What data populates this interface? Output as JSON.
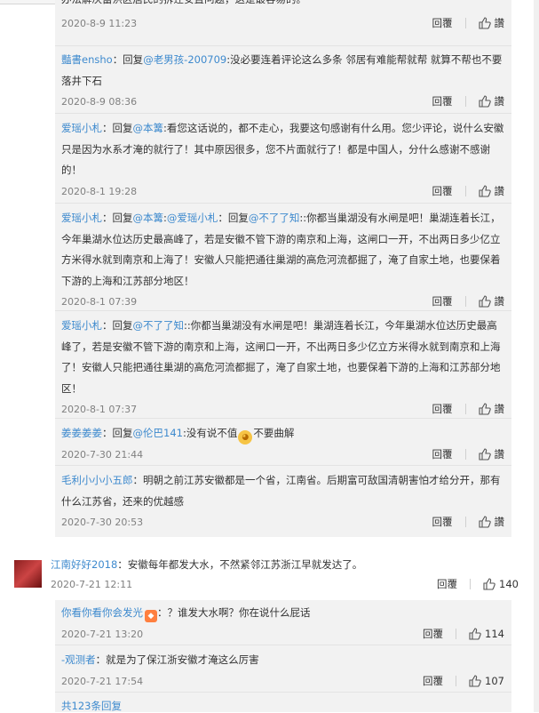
{
  "replies": [
    {
      "user": "",
      "text": "办法解决蓄洪区居民的拆迁安置问题，这是最容易的。",
      "time": "2020-8-9 11:23"
    },
    {
      "user": "豔書ensho",
      "prefix": "：回复",
      "mention": "@老男孩-200709",
      "text": ":没必要连着评论这么多条 邻居有难能帮就帮 就算不帮也不要落井下石",
      "time": "2020-8-9 08:36"
    },
    {
      "user": "爱瑶小札",
      "prefix": "：回复",
      "mention": "@本篝",
      "text": ":看您这话说的，都不走心，我要这句感谢有什么用。您少评论，说什么安徽只是因为水系才淹的就行了！其中原因很多，您不片面就行了！都是中国人，分什么感谢不感谢的！",
      "time": "2020-8-1 19:28"
    },
    {
      "user": "爱瑶小札",
      "prefix": "：回复",
      "mention": "@本篝",
      "mid": ":",
      "mention2": "@爱瑶小札",
      "mid2": "：回复",
      "mention3": "@不了了知",
      "text": "::你都当巢湖没有水闸是吧！巢湖连着长江，今年巢湖水位达历史最高峰了，若是安徽不管下游的南京和上海，这闸口一开，不出两日多少亿立方米得水就到南京和上海了！安徽人只能把通往巢湖的高危河流都掘了，淹了自家土地，也要保着下游的上海和江苏部分地区！",
      "time": "2020-8-1 07:39"
    },
    {
      "user": "爱瑶小札",
      "prefix": "：回复",
      "mention": "@不了了知",
      "text": "::你都当巢湖没有水闸是吧！巢湖连着长江，今年巢湖水位达历史最高峰了，若是安徽不管下游的南京和上海，这闸口一开，不出两日多少亿立方米得水就到南京和上海了！安徽人只能把通往巢湖的高危河流都掘了，淹了自家土地，也要保着下游的上海和江苏部分地区！",
      "time": "2020-8-1 07:37"
    },
    {
      "user": "姜姜姜姜",
      "prefix": "：回复",
      "mention": "@伦巴141",
      "text": ":没有说不值",
      "text2": "不要曲解",
      "time": "2020-7-30 21:44"
    },
    {
      "user": "毛利小小小五郎",
      "prefix": "：",
      "text": "明朝之前江苏安徽都是一个省，江南省。后期富可敌国清朝害怕才给分开，那有什么江苏省，还来的优越感",
      "time": "2020-7-30 20:53"
    }
  ],
  "labels": {
    "reply": "回覆",
    "like": "讚"
  },
  "top_comment": {
    "user": "江南好好2018",
    "text": "：安徽每年都发大水，不然紧邻江苏浙江早就发达了。",
    "time": "2020-7-21 12:11",
    "reply": "回覆",
    "likes": "140"
  },
  "sub_replies": [
    {
      "user": "你看你看你会发光",
      "text": "：？谁发大水啊？你在说什么屁话",
      "time": "2020-7-21 13:20",
      "reply": "回覆",
      "likes": "114"
    },
    {
      "user": "-观测者",
      "text": "：就是为了保江浙安徽才淹这么厉害",
      "time": "2020-7-21 17:54",
      "reply": "回覆",
      "likes": "107"
    }
  ],
  "more_replies": "共123条回复",
  "colors": {
    "link": "#3e8ace",
    "username": "#eb7350",
    "box": "#f2f2f2"
  },
  "icons": {
    "like": "thumbs-up-icon",
    "emoji": "shy-emoji-icon"
  }
}
